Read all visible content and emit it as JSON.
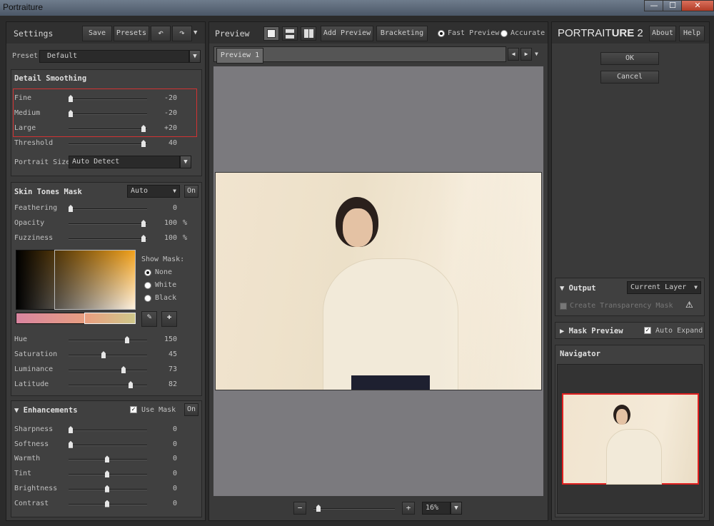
{
  "window": {
    "title": "Portraiture",
    "min": "—",
    "max": "☐",
    "close": "✕"
  },
  "settings": {
    "title": "Settings",
    "save": "Save",
    "presets": "Presets",
    "undo": "↶",
    "redo": "↷",
    "menu": "▼"
  },
  "preset": {
    "label": "Preset",
    "value": "Default"
  },
  "detail": {
    "title": "Detail Smoothing",
    "sliders": [
      {
        "label": "Fine",
        "value": "-20",
        "pos": 0.0
      },
      {
        "label": "Medium",
        "value": "-20",
        "pos": 0.0
      },
      {
        "label": "Large",
        "value": "+20",
        "pos": 1.0
      },
      {
        "label": "Threshold",
        "value": "40",
        "pos": 1.0
      }
    ],
    "portrait_size_label": "Portrait Size",
    "portrait_size_value": "Auto Detect"
  },
  "skin": {
    "title": "Skin Tones Mask",
    "mode": "Auto",
    "on": "On",
    "sliders": [
      {
        "label": "Feathering",
        "value": "0",
        "pos": 0.0
      },
      {
        "label": "Opacity",
        "value": "100",
        "unit": "%",
        "pos": 1.0
      },
      {
        "label": "Fuzziness",
        "value": "100",
        "unit": "%",
        "pos": 1.0
      }
    ],
    "show_mask": "Show Mask:",
    "options": [
      "None",
      "White",
      "Black"
    ],
    "sliders2": [
      {
        "label": "Hue",
        "value": "150",
        "pos": 0.77
      },
      {
        "label": "Saturation",
        "value": "45",
        "pos": 0.45
      },
      {
        "label": "Luminance",
        "value": "73",
        "pos": 0.73
      },
      {
        "label": "Latitude",
        "value": "82",
        "pos": 0.82
      }
    ]
  },
  "enh": {
    "title": "Enhancements",
    "use_mask": "Use Mask",
    "on": "On",
    "sliders": [
      {
        "label": "Sharpness",
        "value": "0",
        "pos": 0.0
      },
      {
        "label": "Softness",
        "value": "0",
        "pos": 0.0
      },
      {
        "label": "Warmth",
        "value": "0",
        "pos": 0.5
      },
      {
        "label": "Tint",
        "value": "0",
        "pos": 0.5
      },
      {
        "label": "Brightness",
        "value": "0",
        "pos": 0.5
      },
      {
        "label": "Contrast",
        "value": "0",
        "pos": 0.5
      }
    ]
  },
  "preview": {
    "title": "Preview",
    "add_preview": "Add Preview",
    "bracketing": "Bracketing",
    "fast": "Fast Preview",
    "accurate": "Accurate",
    "tab": "Preview 1",
    "zoom": "16%",
    "minus": "−",
    "plus": "+"
  },
  "right": {
    "brand_a": "Portrait",
    "brand_b": "ure",
    "brand_num": "2",
    "about": "About",
    "help": "Help",
    "ok": "OK",
    "cancel": "Cancel",
    "output": "Output",
    "output_value": "Current Layer",
    "transparency": "Create Transparency Mask",
    "mask_preview": "Mask Preview",
    "auto_expand": "Auto Expand",
    "navigator": "Navigator"
  }
}
